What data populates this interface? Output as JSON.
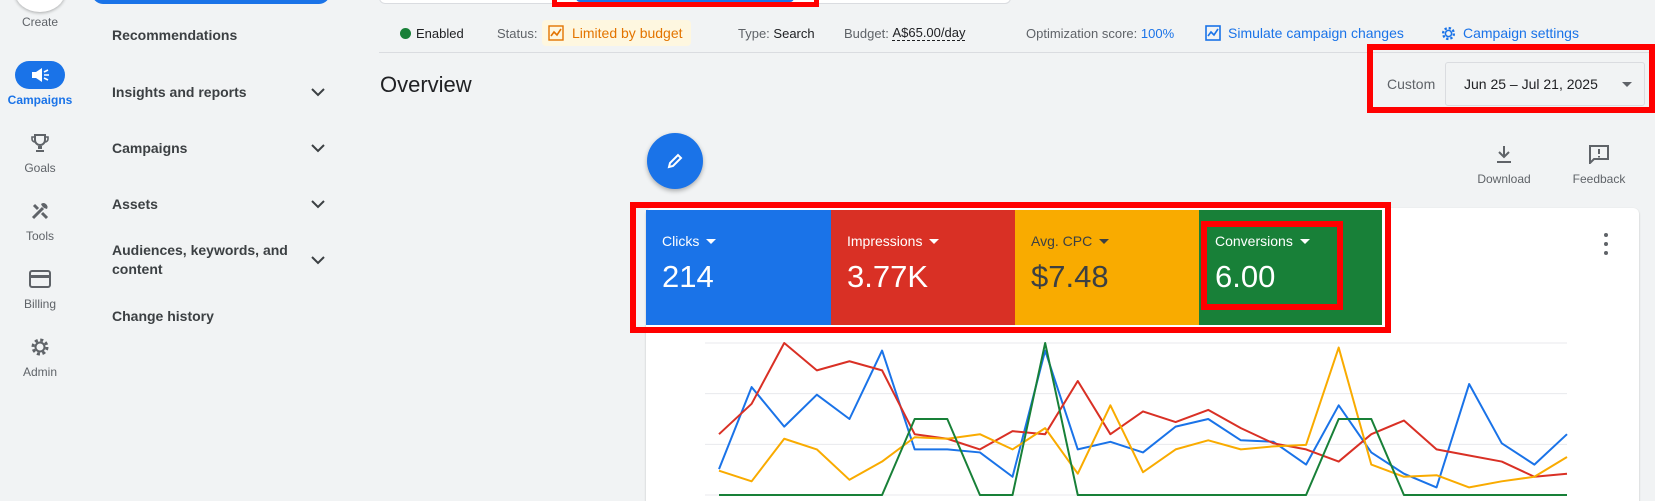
{
  "rail": {
    "create_label": "Create",
    "items": [
      {
        "label": "Campaigns",
        "icon": "megaphone-icon"
      },
      {
        "label": "Goals",
        "icon": "trophy-icon"
      },
      {
        "label": "Tools",
        "icon": "tools-icon"
      },
      {
        "label": "Billing",
        "icon": "credit-card-icon"
      },
      {
        "label": "Admin",
        "icon": "gear-icon"
      }
    ]
  },
  "nav": {
    "items": [
      {
        "label": "Recommendations"
      },
      {
        "label": "Insights and reports"
      },
      {
        "label": "Campaigns"
      },
      {
        "label": "Assets"
      },
      {
        "label": "Audiences, keywords, and content"
      },
      {
        "label": "Change history"
      }
    ]
  },
  "status": {
    "enabled": "Enabled",
    "status_label": "Status:",
    "status_value": "Limited by budget",
    "type_label": "Type:",
    "type_value": "Search",
    "budget_label": "Budget:",
    "budget_value": "A$65.00/day",
    "opt_label": "Optimization score:",
    "opt_value": "100%",
    "simulate": "Simulate campaign changes",
    "settings": "Campaign settings"
  },
  "overview": {
    "title": "Overview",
    "custom_label": "Custom",
    "date_range": "Jun 25 – Jul 21, 2025",
    "download": "Download",
    "feedback": "Feedback"
  },
  "metrics": [
    {
      "label": "Clicks",
      "value": "214",
      "color": "#1a73e8"
    },
    {
      "label": "Impressions",
      "value": "3.77K",
      "color": "#d93025"
    },
    {
      "label": "Avg. CPC",
      "value": "$7.48",
      "color": "#f9ab00"
    },
    {
      "label": "Conversions",
      "value": "6.00",
      "color": "#188038"
    }
  ],
  "chart_data": {
    "type": "line",
    "x": [
      1,
      2,
      3,
      4,
      5,
      6,
      7,
      8,
      9,
      10,
      11,
      12,
      13,
      14,
      15,
      16,
      17,
      18,
      19,
      20,
      21,
      22,
      23,
      24,
      25,
      26,
      27
    ],
    "ylim": [
      0,
      1
    ],
    "grid": true,
    "series": [
      {
        "color": "#1a73e8",
        "values": [
          0.17,
          0.71,
          0.45,
          0.66,
          0.5,
          0.95,
          0.3,
          0.3,
          0.28,
          0.12,
          0.95,
          0.3,
          0.35,
          0.28,
          0.45,
          0.5,
          0.36,
          0.35,
          0.2,
          0.59,
          0.28,
          0.14,
          0.05,
          0.73,
          0.34,
          0.2,
          0.4
        ]
      },
      {
        "color": "#d93025",
        "values": [
          0.4,
          0.6,
          1.0,
          0.82,
          0.88,
          0.82,
          0.4,
          0.37,
          0.3,
          0.42,
          0.4,
          0.75,
          0.4,
          0.55,
          0.48,
          0.56,
          0.44,
          0.34,
          0.3,
          0.22,
          0.4,
          0.49,
          0.3,
          0.26,
          0.22,
          0.12,
          0.14
        ]
      },
      {
        "color": "#f9ab00",
        "values": [
          0.16,
          0.09,
          0.37,
          0.3,
          0.1,
          0.22,
          0.38,
          0.37,
          0.4,
          0.3,
          0.44,
          0.14,
          0.59,
          0.15,
          0.3,
          0.36,
          0.3,
          0.32,
          0.33,
          0.97,
          0.2,
          0.12,
          0.13,
          0.05,
          0.09,
          0.12,
          0.25
        ]
      },
      {
        "color": "#188038",
        "values": [
          0.0,
          0.0,
          0.0,
          0.0,
          0.0,
          0.0,
          0.5,
          0.5,
          0.0,
          0.0,
          1.0,
          0.0,
          0.0,
          0.0,
          0.0,
          0.0,
          0.0,
          0.0,
          0.0,
          0.5,
          0.5,
          0.0,
          0.0,
          0.0,
          0.0,
          0.0,
          0.0
        ]
      }
    ]
  }
}
